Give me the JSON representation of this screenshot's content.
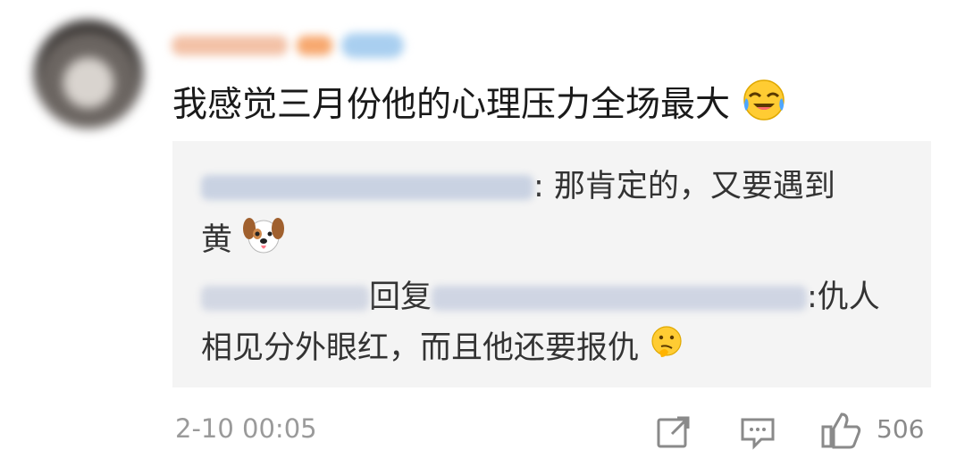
{
  "comment": {
    "text": "我感觉三月份他的心理压力全场最大",
    "time": "2-10 00:05",
    "emoji": "laughing-crying-face"
  },
  "replies": [
    {
      "text_line1": ": 那肯定的，又要遇到",
      "text_line2": "黄",
      "emoji": "dog-face"
    },
    {
      "reply_word": "回复",
      "text_line1_tail": ":仇人",
      "text_line2": "相见分外眼红，而且他还要报仇",
      "emoji": "thinking-face"
    }
  ],
  "actions": {
    "like_count": "506",
    "share_icon": "share-icon",
    "comment_icon": "comment-icon",
    "like_icon": "thumbs-up-icon"
  },
  "colors": {
    "reply_bg": "#f4f4f4",
    "time_gray": "#9a9a9a"
  }
}
